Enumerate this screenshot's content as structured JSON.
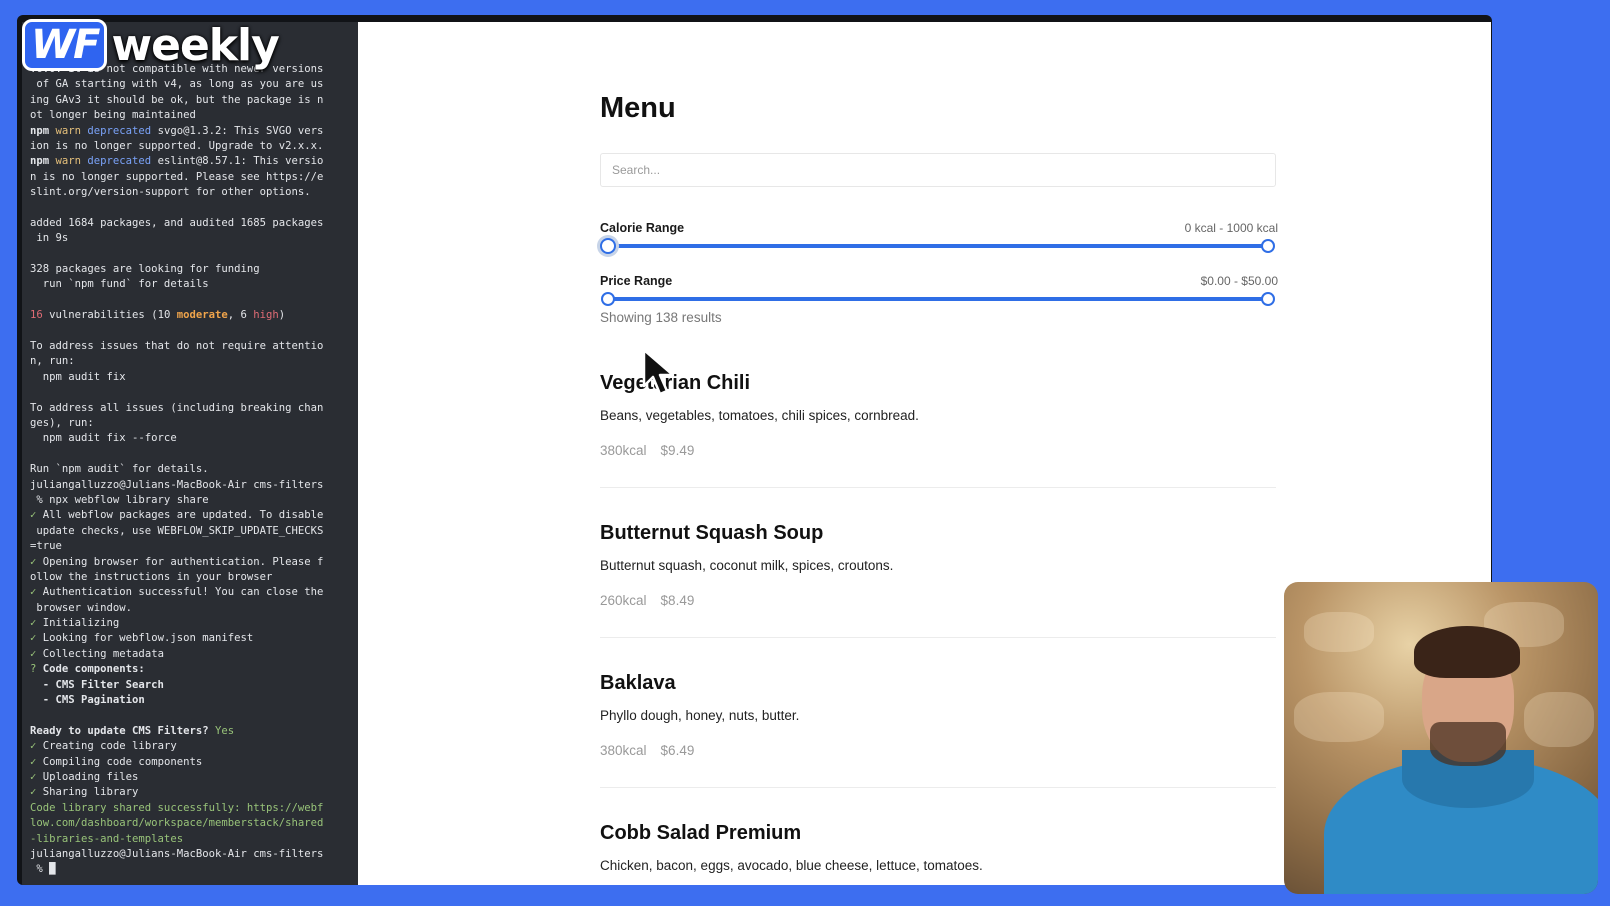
{
  "logo": {
    "wf": "WF",
    "weekly": "weekly"
  },
  "terminal": {
    "lines": [
      [
        {
          "t": ".6.0: It is not compatible with newer versions"
        }
      ],
      [
        {
          "t": " of GA starting with v4, as long as you are us"
        }
      ],
      [
        {
          "t": "ing GAv3 it should be ok, but the package is n"
        }
      ],
      [
        {
          "t": "ot longer being maintained"
        }
      ],
      [
        {
          "t": "npm ",
          "c": "c-bold"
        },
        {
          "t": "warn ",
          "c": "c-yellow"
        },
        {
          "t": "deprecated ",
          "c": "c-blue"
        },
        {
          "t": "svgo@1.3.2: This SVGO vers"
        }
      ],
      [
        {
          "t": "ion is no longer supported. Upgrade to v2.x.x."
        }
      ],
      [
        {
          "t": "npm ",
          "c": "c-bold"
        },
        {
          "t": "warn ",
          "c": "c-yellow"
        },
        {
          "t": "deprecated ",
          "c": "c-blue"
        },
        {
          "t": "eslint@8.57.1: This versio"
        }
      ],
      [
        {
          "t": "n is no longer supported. Please see https://e"
        }
      ],
      [
        {
          "t": "slint.org/version-support for other options."
        }
      ],
      [
        {
          "t": ""
        }
      ],
      [
        {
          "t": "added 1684 packages, and audited 1685 packages"
        }
      ],
      [
        {
          "t": " in 9s"
        }
      ],
      [
        {
          "t": ""
        }
      ],
      [
        {
          "t": "328 packages are looking for funding"
        }
      ],
      [
        {
          "t": "  run `npm fund` for details"
        }
      ],
      [
        {
          "t": ""
        }
      ],
      [
        {
          "t": "16 ",
          "c": "c-red"
        },
        {
          "t": "vulnerabilities (10 "
        },
        {
          "t": "moderate",
          "c": "c-orange"
        },
        {
          "t": ", 6 "
        },
        {
          "t": "high",
          "c": "c-red"
        },
        {
          "t": ")"
        }
      ],
      [
        {
          "t": ""
        }
      ],
      [
        {
          "t": "To address issues that do not require attentio"
        }
      ],
      [
        {
          "t": "n, run:"
        }
      ],
      [
        {
          "t": "  npm audit fix"
        }
      ],
      [
        {
          "t": ""
        }
      ],
      [
        {
          "t": "To address all issues (including breaking chan"
        }
      ],
      [
        {
          "t": "ges), run:"
        }
      ],
      [
        {
          "t": "  npm audit fix --force"
        }
      ],
      [
        {
          "t": ""
        }
      ],
      [
        {
          "t": "Run `npm audit` for details."
        }
      ],
      [
        {
          "t": "juliangalluzzo@Julians-MacBook-Air cms-filters"
        }
      ],
      [
        {
          "t": " % npx webflow library share"
        }
      ],
      [
        {
          "t": "✓ ",
          "c": "c-check"
        },
        {
          "t": "All webflow packages are updated. To disable"
        }
      ],
      [
        {
          "t": " update checks, use WEBFLOW_SKIP_UPDATE_CHECKS"
        }
      ],
      [
        {
          "t": "=true"
        }
      ],
      [
        {
          "t": "✓ ",
          "c": "c-check"
        },
        {
          "t": "Opening browser for authentication. Please f"
        }
      ],
      [
        {
          "t": "ollow the instructions in your browser"
        }
      ],
      [
        {
          "t": "✓ ",
          "c": "c-check"
        },
        {
          "t": "Authentication successful! You can close the"
        }
      ],
      [
        {
          "t": " browser window."
        }
      ],
      [
        {
          "t": "✓ ",
          "c": "c-check"
        },
        {
          "t": "Initializing"
        }
      ],
      [
        {
          "t": "✓ ",
          "c": "c-check"
        },
        {
          "t": "Looking for webflow.json manifest"
        }
      ],
      [
        {
          "t": "✓ ",
          "c": "c-check"
        },
        {
          "t": "Collecting metadata"
        }
      ],
      [
        {
          "t": "? ",
          "c": "c-green"
        },
        {
          "t": "Code components:",
          "c": "c-bold"
        }
      ],
      [
        {
          "t": "  - CMS Filter Search",
          "c": "c-bold"
        }
      ],
      [
        {
          "t": "  - CMS Pagination",
          "c": "c-bold"
        }
      ],
      [
        {
          "t": ""
        }
      ],
      [
        {
          "t": "Ready to update CMS Filters? ",
          "c": "c-bold"
        },
        {
          "t": "Yes",
          "c": "c-green"
        }
      ],
      [
        {
          "t": "✓ ",
          "c": "c-check"
        },
        {
          "t": "Creating code library"
        }
      ],
      [
        {
          "t": "✓ ",
          "c": "c-check"
        },
        {
          "t": "Compiling code components"
        }
      ],
      [
        {
          "t": "✓ ",
          "c": "c-check"
        },
        {
          "t": "Uploading files"
        }
      ],
      [
        {
          "t": "✓ ",
          "c": "c-check"
        },
        {
          "t": "Sharing library"
        }
      ],
      [
        {
          "t": "Code library shared successfully: https://webf",
          "c": "c-green"
        }
      ],
      [
        {
          "t": "low.com/dashboard/workspace/memberstack/shared",
          "c": "c-green"
        }
      ],
      [
        {
          "t": "-libraries-and-templates",
          "c": "c-green"
        }
      ],
      [
        {
          "t": "juliangalluzzo@Julians-MacBook-Air cms-filters"
        }
      ],
      [
        {
          "t": " % █"
        }
      ]
    ]
  },
  "menu": {
    "title": "Menu",
    "search_placeholder": "Search...",
    "calorie": {
      "label": "Calorie Range",
      "value_text": "0 kcal - 1000 kcal",
      "min_fraction": 0.0,
      "max_fraction": 1.0
    },
    "price": {
      "label": "Price Range",
      "value_text": "$0.00 - $50.00",
      "min_fraction": 0.0,
      "max_fraction": 1.0
    },
    "results_text": "Showing 138 results",
    "items": [
      {
        "name": "Vegetarian Chili",
        "desc": "Beans, vegetables, tomatoes, chili spices, cornbread.",
        "kcal": "380kcal",
        "price": "$9.49"
      },
      {
        "name": "Butternut Squash Soup",
        "desc": "Butternut squash, coconut milk, spices, croutons.",
        "kcal": "260kcal",
        "price": "$8.49"
      },
      {
        "name": "Baklava",
        "desc": "Phyllo dough, honey, nuts, butter.",
        "kcal": "380kcal",
        "price": "$6.49"
      },
      {
        "name": "Cobb Salad Premium",
        "desc": "Chicken, bacon, eggs, avocado, blue cheese, lettuce, tomatoes.",
        "kcal": "",
        "price": ""
      }
    ]
  },
  "colors": {
    "background": "#3d6ef0",
    "accent": "#2f6ee6"
  }
}
